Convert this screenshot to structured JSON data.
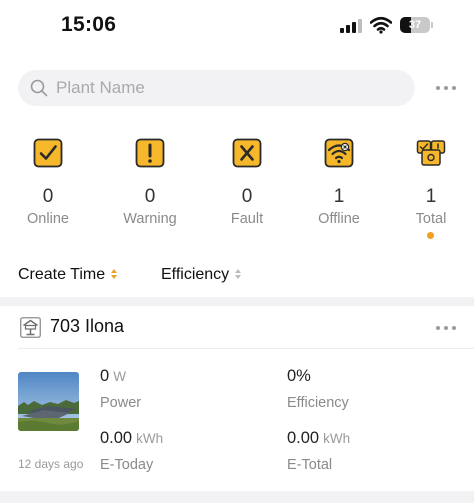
{
  "status_bar": {
    "time": "15:06",
    "battery": "37",
    "battery_level": 0.37
  },
  "search": {
    "placeholder": "Plant Name"
  },
  "summary": [
    {
      "count": "0",
      "label": "Online",
      "icon": "online-check-icon"
    },
    {
      "count": "0",
      "label": "Warning",
      "icon": "warning-exclamation-icon"
    },
    {
      "count": "0",
      "label": "Fault",
      "icon": "fault-x-icon"
    },
    {
      "count": "1",
      "label": "Offline",
      "icon": "offline-wifi-icon"
    },
    {
      "count": "1",
      "label": "Total",
      "icon": "total-stack-icon",
      "selected": true
    }
  ],
  "sort": {
    "create_time": "Create Time",
    "efficiency": "Efficiency"
  },
  "plant": {
    "name": "703 Ilona",
    "updated": "12 days ago",
    "power": {
      "value": "0",
      "unit": "W",
      "label": "Power"
    },
    "efficiency": {
      "value": "0%",
      "label": "Efficiency"
    },
    "e_today": {
      "value": "0.00",
      "unit": "kWh",
      "label": "E-Today"
    },
    "e_total": {
      "value": "0.00",
      "unit": "kWh",
      "label": "E-Total"
    }
  },
  "colors": {
    "accent": "#f0a020",
    "icon_fill": "#f6b82a",
    "icon_stroke": "#2a2a2a",
    "divider": "#f2f2f4"
  }
}
